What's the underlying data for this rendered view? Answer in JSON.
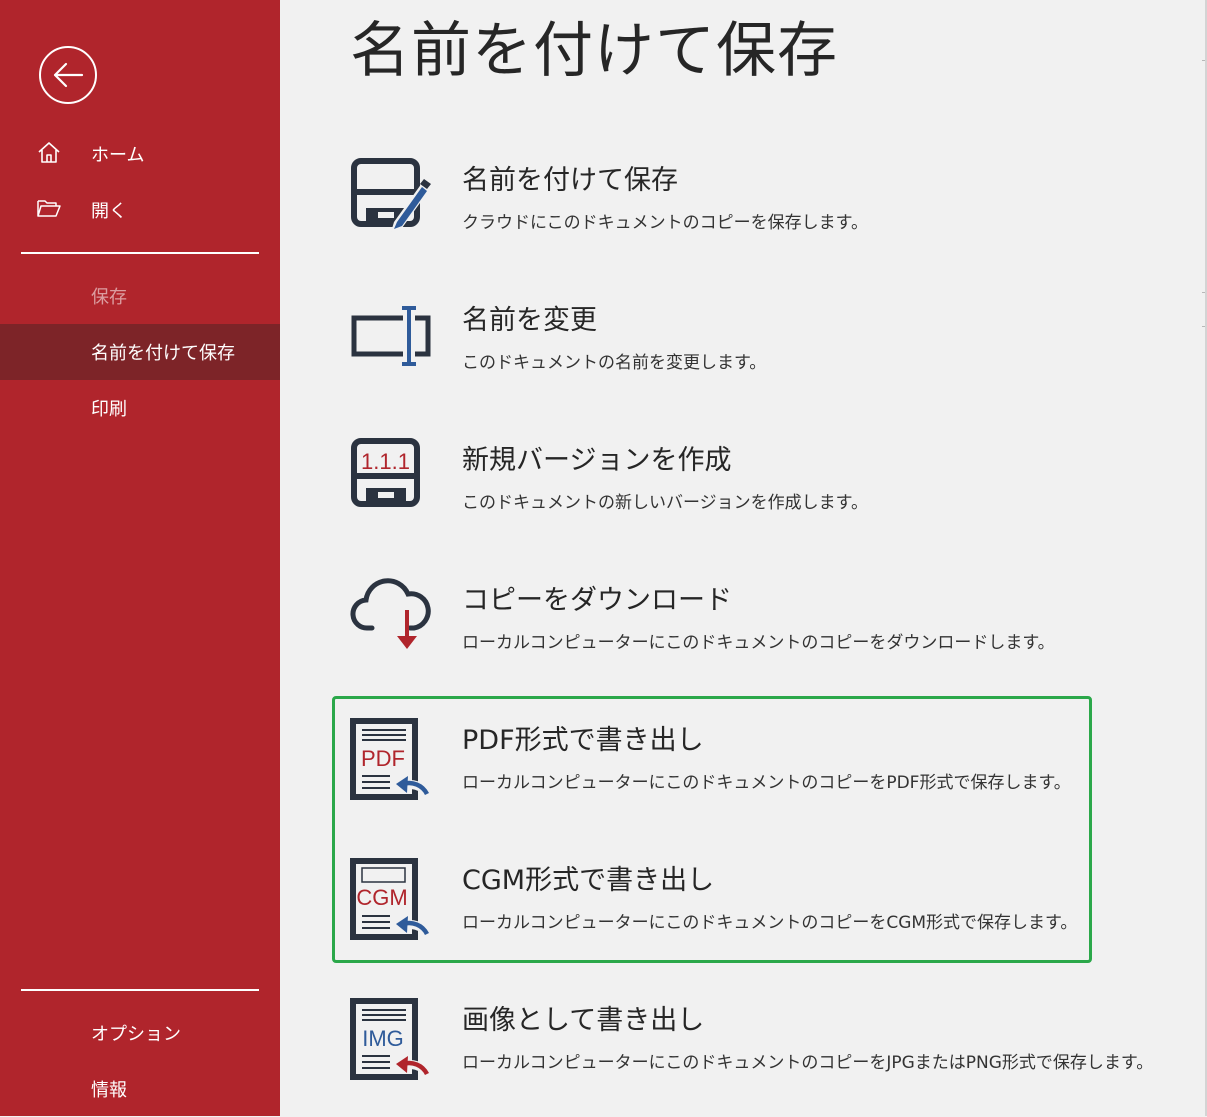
{
  "colors": {
    "sidebar": "#b0252c",
    "selected": "#7d2428",
    "highlight": "#2ba84a",
    "icon_dark": "#2b3340",
    "icon_red": "#b0252c",
    "icon_blue": "#2f5b9a"
  },
  "sidebar": {
    "back_icon": "arrow-left-icon",
    "items": [
      {
        "label": "ホーム",
        "icon": "home-icon"
      },
      {
        "label": "開く",
        "icon": "folder-open-icon"
      },
      {
        "label": "保存",
        "state": "disabled"
      },
      {
        "label": "名前を付けて保存",
        "state": "selected"
      },
      {
        "label": "印刷"
      }
    ],
    "bottom_items": [
      {
        "label": "オプション"
      },
      {
        "label": "情報"
      }
    ]
  },
  "main": {
    "title": "名前を付けて保存",
    "options": [
      {
        "title": "名前を付けて保存",
        "desc": "クラウドにこのドキュメントのコピーを保存します。",
        "icon": "save-as-icon"
      },
      {
        "title": "名前を変更",
        "desc": "このドキュメントの名前を変更します。",
        "icon": "rename-icon"
      },
      {
        "title": "新規バージョンを作成",
        "desc": "このドキュメントの新しいバージョンを作成します。",
        "icon": "new-version-icon",
        "icon_text": "1.1.1"
      },
      {
        "title": "コピーをダウンロード",
        "desc": "ローカルコンピューターにこのドキュメントのコピーをダウンロードします。",
        "icon": "cloud-download-icon"
      },
      {
        "title": "PDF形式で書き出し",
        "desc": "ローカルコンピューターにこのドキュメントのコピーをPDF形式で保存します。",
        "icon": "pdf-export-icon",
        "icon_text": "PDF"
      },
      {
        "title": "CGM形式で書き出し",
        "desc": "ローカルコンピューターにこのドキュメントのコピーをCGM形式で保存します。",
        "icon": "cgm-export-icon",
        "icon_text": "CGM"
      },
      {
        "title": "画像として書き出し",
        "desc": "ローカルコンピューターにこのドキュメントのコピーをJPGまたはPNG形式で保存します。",
        "icon": "image-export-icon",
        "icon_text": "IMG"
      }
    ]
  }
}
